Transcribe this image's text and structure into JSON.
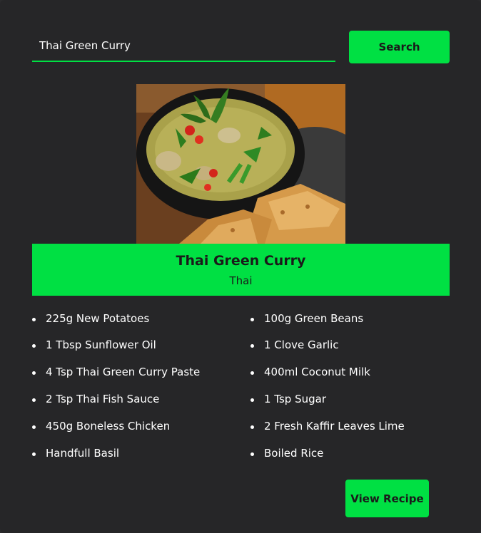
{
  "search": {
    "value": "Thai Green Curry",
    "button_label": "Search"
  },
  "meal": {
    "title": "Thai Green Curry",
    "area": "Thai",
    "image_icon": "meal-photo"
  },
  "ingredients": {
    "left": [
      "225g New Potatoes",
      "1 Tbsp Sunflower Oil",
      "4 Tsp Thai Green Curry Paste",
      "2 Tsp Thai Fish Sauce",
      "450g Boneless Chicken",
      "Handfull Basil"
    ],
    "right": [
      "100g Green Beans",
      "1 Clove Garlic",
      "400ml Coconut Milk",
      "1 Tsp Sugar",
      "2 Fresh Kaffir Leaves Lime",
      "Boiled Rice"
    ]
  },
  "actions": {
    "view_recipe_label": "View Recipe"
  },
  "colors": {
    "accent": "#00e043",
    "background": "#262628",
    "text": "#ffffff"
  }
}
